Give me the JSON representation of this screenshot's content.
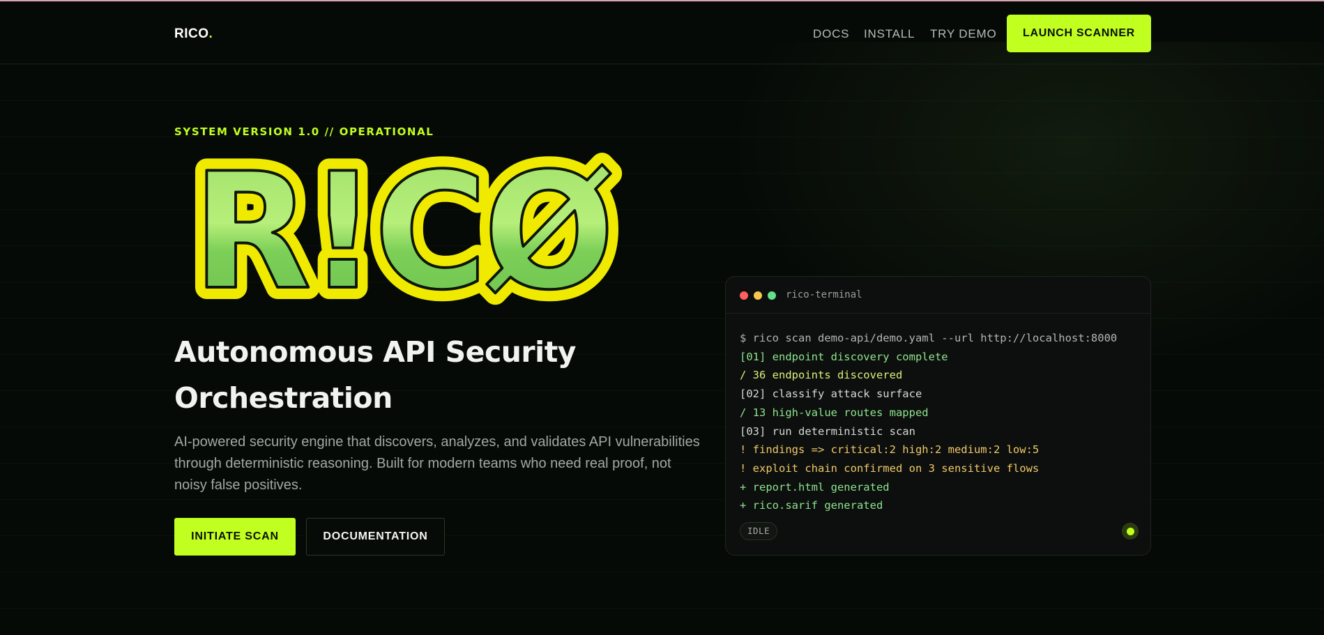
{
  "brand": {
    "name": "RICO",
    "dot": "."
  },
  "nav": {
    "links": [
      "DOCS",
      "INSTALL",
      "TRY DEMO"
    ],
    "cta": "LAUNCH SCANNER"
  },
  "hero": {
    "eyebrow": "SYSTEM VERSION 1.0 // OPERATIONAL",
    "logo_text": "R!CØ",
    "headline_line1": "Autonomous API Security",
    "headline_line2": "Orchestration",
    "lede": "AI-powered security engine that discovers, analyzes, and validates API vulnerabilities through deterministic reasoning. Built for modern teams who need real proof, not noisy false positives.",
    "primary_button": "INITIATE SCAN",
    "secondary_button": "DOCUMENTATION"
  },
  "terminal": {
    "title": "rico-terminal",
    "lines": [
      {
        "text": "$ rico scan demo-api/demo.yaml --url http://localhost:8000",
        "color": "#b3b8b3"
      },
      {
        "text": "[01] endpoint discovery complete",
        "color": "#8fe38f"
      },
      {
        "text": "/ 36 endpoints discovered",
        "color": "#d8f27a"
      },
      {
        "text": "[02] classify attack surface",
        "color": "#d6dad6"
      },
      {
        "text": "/ 13 high-value routes mapped",
        "color": "#8fe38f"
      },
      {
        "text": "[03] run deterministic scan",
        "color": "#d6dad6"
      },
      {
        "text": "! findings => critical:2 high:2 medium:2 low:5",
        "color": "#f2c96b"
      },
      {
        "text": "! exploit chain confirmed on 3 sensitive flows",
        "color": "#f2c96b"
      },
      {
        "text": "+ report.html generated",
        "color": "#8fe38f"
      },
      {
        "text": "+ rico.sarif generated",
        "color": "#8fe38f"
      }
    ],
    "status": "IDLE"
  },
  "colors": {
    "accent": "#c0ff1f",
    "background": "#060a07",
    "traffic_red": "#ff5f5f",
    "traffic_yellow": "#f5c84c",
    "traffic_green": "#63e08a"
  }
}
